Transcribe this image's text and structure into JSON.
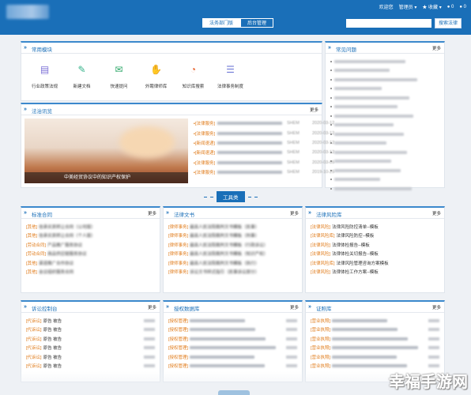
{
  "header": {
    "user_links": [
      "欢迎您",
      "管理员",
      "收藏",
      "0",
      "0"
    ],
    "tabs": [
      "法务部门版",
      "后台管理"
    ],
    "search_placeholder": "",
    "search_button": "搜索法律"
  },
  "common_modules": {
    "title": "常用模块",
    "items": [
      {
        "label": "行业政策法规",
        "icon": "book-icon",
        "color": "#7b6fd6"
      },
      {
        "label": "新建文档",
        "icon": "edit-doc-icon",
        "color": "#35b38a"
      },
      {
        "label": "快速提问",
        "icon": "chat-icon",
        "color": "#2fa86a"
      },
      {
        "label": "外聘律师库",
        "icon": "handshake-icon",
        "color": "#3fa84a"
      },
      {
        "label": "知识库搜索",
        "icon": "pie-chart-icon",
        "color": "#e8622c"
      },
      {
        "label": "法律事务制度",
        "icon": "stack-icon",
        "color": "#6f7ad6"
      }
    ]
  },
  "faq": {
    "title": "常见问题",
    "more": "更多",
    "count": 15
  },
  "legal_news": {
    "title": "法治讯览",
    "more": "更多",
    "banner_caption": "中美经贸协议中的知识产权保护",
    "rows": [
      {
        "tag": "[法律服务]",
        "src": "SHEM",
        "date": "2020-03-12"
      },
      {
        "tag": "[法律服务]",
        "src": "SHEM",
        "date": "2020-03-12"
      },
      {
        "tag": "[新闻速递]",
        "src": "SHEM",
        "date": "2020-03-12"
      },
      {
        "tag": "[新闻速递]",
        "src": "SHEM",
        "date": "2020-03-12"
      },
      {
        "tag": "[法律服务]",
        "src": "SHEM",
        "date": "2020-03-05"
      },
      {
        "tag": "[法律服务]",
        "src": "SHEM",
        "date": "2019-10-25"
      }
    ]
  },
  "divider_label": "工具类",
  "panels": [
    {
      "title": "标准合同",
      "more": "更多",
      "rows": [
        {
          "tag": "[其他]",
          "text": "信承买卖转让合同（公司版）"
        },
        {
          "tag": "[其他]",
          "text": "信承买卖转让合同（个人版）"
        },
        {
          "tag": "[劳动合同]",
          "text": "产品推广服务协议"
        },
        {
          "tag": "[劳动合同]",
          "text": "商品供应链服务协议"
        },
        {
          "tag": "[其他]",
          "text": "渠道推广合作协议"
        },
        {
          "tag": "[其他]",
          "text": "会议组织服务合同"
        }
      ]
    },
    {
      "title": "法律文书",
      "more": "更多",
      "rows": [
        {
          "tag": "[律师事务]",
          "text": "最高人民法院裁判文书模板（民事）"
        },
        {
          "tag": "[律师事务]",
          "text": "最高人民法院裁判文书模板（刑事）"
        },
        {
          "tag": "[律师事务]",
          "text": "最高人民法院裁判文书模板（行政诉讼）"
        },
        {
          "tag": "[律师事务]",
          "text": "最高人民法院裁判文书模板（知识产权）"
        },
        {
          "tag": "[律师事务]",
          "text": "最高人民法院裁判文书模板（执行）"
        },
        {
          "tag": "[律师事务]",
          "text": "诉讼文书样式指引（民事诉讼部分）"
        }
      ]
    },
    {
      "title": "法律风险库",
      "more": "更多",
      "rows": [
        {
          "tag": "[法律风险]",
          "text": "法律风险防控清单--模板"
        },
        {
          "tag": "[法律风险库]",
          "text": "法律风险防控--模板"
        },
        {
          "tag": "[法律风险]",
          "text": "法律体检报告--模板"
        },
        {
          "tag": "[法律风险]",
          "text": "法律体检关切报告--模板"
        },
        {
          "tag": "[法律风险库]",
          "text": "法律风险管理咨询方案模板"
        },
        {
          "tag": "[法律风险]",
          "text": "法律体检工作方案--模板"
        }
      ]
    },
    {
      "title": "诉讼控制台",
      "more": "更多",
      "rows": [
        {
          "tag": "[代诉讼]",
          "text": "原告 被告"
        },
        {
          "tag": "[代诉讼]",
          "text": "原告 被告"
        },
        {
          "tag": "[代诉讼]",
          "text": "原告 被告"
        },
        {
          "tag": "[代诉讼]",
          "text": "原告 被告"
        },
        {
          "tag": "[代诉讼]",
          "text": "原告 被告"
        },
        {
          "tag": "[代诉讼]",
          "text": "原告 被告"
        }
      ]
    },
    {
      "title": "授权数据库",
      "more": "更多",
      "rows": [
        {
          "tag": "[授权管理]",
          "text": ""
        },
        {
          "tag": "[授权管理]",
          "text": ""
        },
        {
          "tag": "[授权管理]",
          "text": ""
        },
        {
          "tag": "[授权管理]",
          "text": ""
        },
        {
          "tag": "[授权管理]",
          "text": ""
        },
        {
          "tag": "[授权管理]",
          "text": ""
        }
      ]
    },
    {
      "title": "证照库",
      "more": "更多",
      "rows": [
        {
          "tag": "[营业执照]",
          "text": ""
        },
        {
          "tag": "[营业执照]",
          "text": ""
        },
        {
          "tag": "[营业执照]",
          "text": ""
        },
        {
          "tag": "[营业执照]",
          "text": ""
        },
        {
          "tag": "[营业执照]",
          "text": ""
        },
        {
          "tag": "[营业执照]",
          "text": ""
        }
      ]
    }
  ],
  "watermark": "幸福手游网"
}
